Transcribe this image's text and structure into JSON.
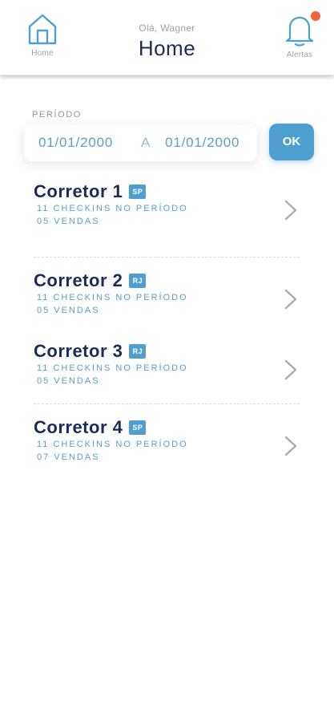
{
  "header": {
    "greeting": "Olá, Wagner",
    "title": "Home",
    "home_label": "Home",
    "alerts_label": "Alertas",
    "alert_dot_color": "#f0643a"
  },
  "period": {
    "label": "PERÍODO",
    "start": "01/01/2000",
    "separator": "A",
    "end": "01/01/2000",
    "ok_label": "OK"
  },
  "brokers": [
    {
      "name": "Corretor 1",
      "state": "SP",
      "checkins": "11 CHECKINS NO PERÍODO",
      "sales": "05 VENDAS"
    },
    {
      "name": "Corretor 2",
      "state": "RJ",
      "checkins": "11 CHECKINS NO PERÍODO",
      "sales": "05 VENDAS"
    },
    {
      "name": "Corretor 3",
      "state": "RJ",
      "checkins": "11 CHECKINS NO PERÍODO",
      "sales": "05 VENDAS"
    },
    {
      "name": "Corretor 4",
      "state": "SP",
      "checkins": "11 CHECKINS NO PERÍODO",
      "sales": "07 VENDAS"
    }
  ],
  "colors": {
    "accent": "#4e9fd0",
    "title": "#1d2b5c",
    "subtext": "#5b9fc9"
  }
}
